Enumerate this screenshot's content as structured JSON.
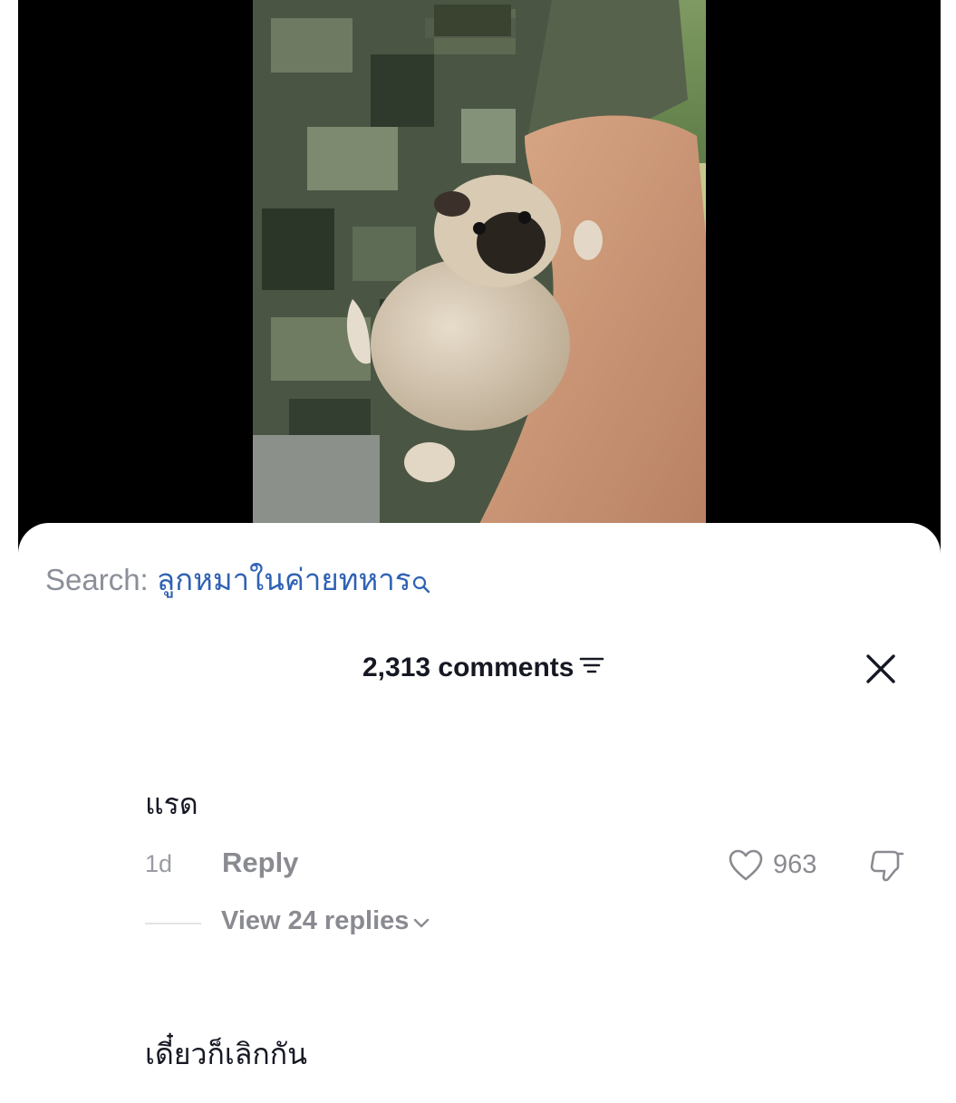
{
  "video": {
    "alt": "soldier holding pug puppy"
  },
  "search": {
    "label": "Search:",
    "query": "ลูกหมาในค่ายทหาร"
  },
  "comments_panel": {
    "count_label": "2,313 comments"
  },
  "comments": [
    {
      "text": "แรด",
      "time": "1d",
      "reply_label": "Reply",
      "likes": "963",
      "view_replies_label": "View 24 replies"
    },
    {
      "text": "เดี๋ยวก็เลิกกัน"
    }
  ],
  "colors": {
    "search_query": "#2f62b3",
    "muted_text": "#8a8b91",
    "primary_text": "#161823",
    "backdrop": "#000000"
  }
}
